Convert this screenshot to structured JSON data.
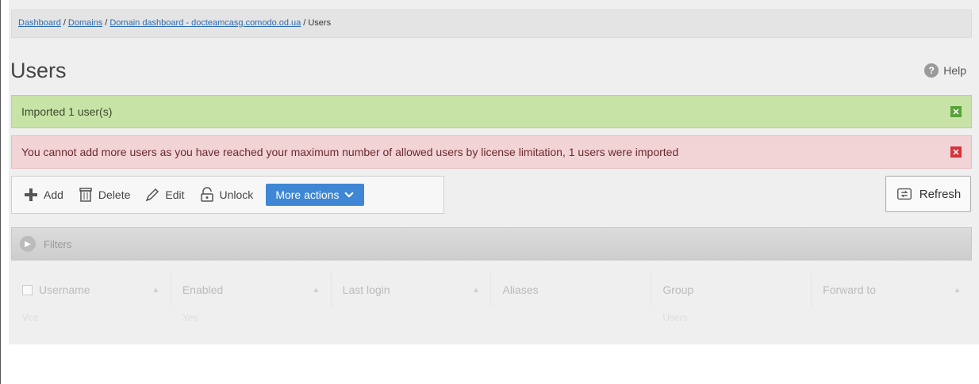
{
  "breadcrumb": {
    "items": [
      {
        "label": "Dashboard",
        "link": true
      },
      {
        "label": "Domains",
        "link": true
      },
      {
        "label": "Domain dashboard - docteamcasg.comodo.od.ua",
        "link": true
      },
      {
        "label": "Users",
        "link": false
      }
    ],
    "separator": "/"
  },
  "page": {
    "title": "Users",
    "help_label": "Help"
  },
  "alerts": {
    "success": "Imported 1 user(s)",
    "error": "You cannot add more users as you have reached your maximum number of allowed users by license limitation, 1 users were imported"
  },
  "toolbar": {
    "add_label": "Add",
    "delete_label": "Delete",
    "edit_label": "Edit",
    "unlock_label": "Unlock",
    "more_label": "More actions",
    "refresh_label": "Refresh"
  },
  "filters": {
    "label": "Filters"
  },
  "table": {
    "columns": [
      "Username",
      "Enabled",
      "Last login",
      "Aliases",
      "Group",
      "Forward to"
    ],
    "row": [
      "Vcs",
      "Yes",
      "",
      "",
      "Users",
      ""
    ]
  },
  "colors": {
    "success_bg": "#c8e3a6",
    "error_bg": "#f2d3d6",
    "primary_button": "#3f86d4",
    "link": "#2a6bb3"
  }
}
